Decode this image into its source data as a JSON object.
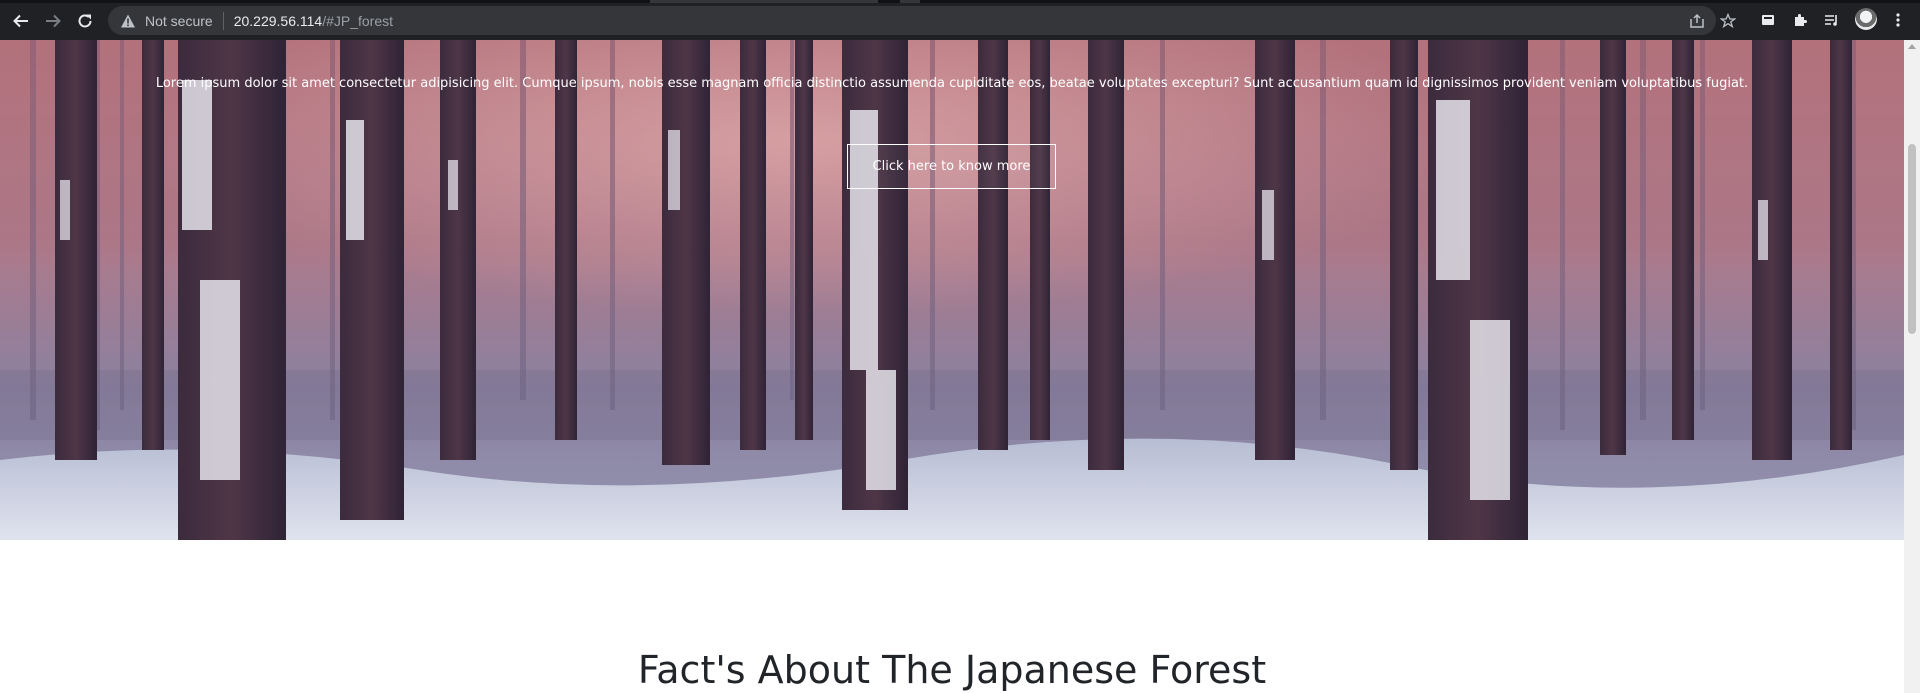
{
  "browser": {
    "security_label": "Not secure",
    "url_host": "20.229.56.114",
    "url_path": "/#JP_forest",
    "icons": [
      "back-icon",
      "forward-icon",
      "reload-icon",
      "warning-icon",
      "share-icon",
      "star-icon",
      "cast-icon",
      "extensions-icon",
      "reading-list-icon",
      "profile-avatar",
      "menu-icon"
    ]
  },
  "hero": {
    "paragraph": "Lorem ipsum dolor sit amet consectetur adipisicing elit. Cumque ipsum, nobis esse magnam officia distinctio assumenda cupiditate eos, beatae voluptates excepturi? Sunt accusantium quam id dignissimos provident veniam voluptatibus fugiat.",
    "button_label": "Click here to know more",
    "overlay_color": "#a0505f"
  },
  "section": {
    "title": "Fact's About The Japanese Forest"
  }
}
